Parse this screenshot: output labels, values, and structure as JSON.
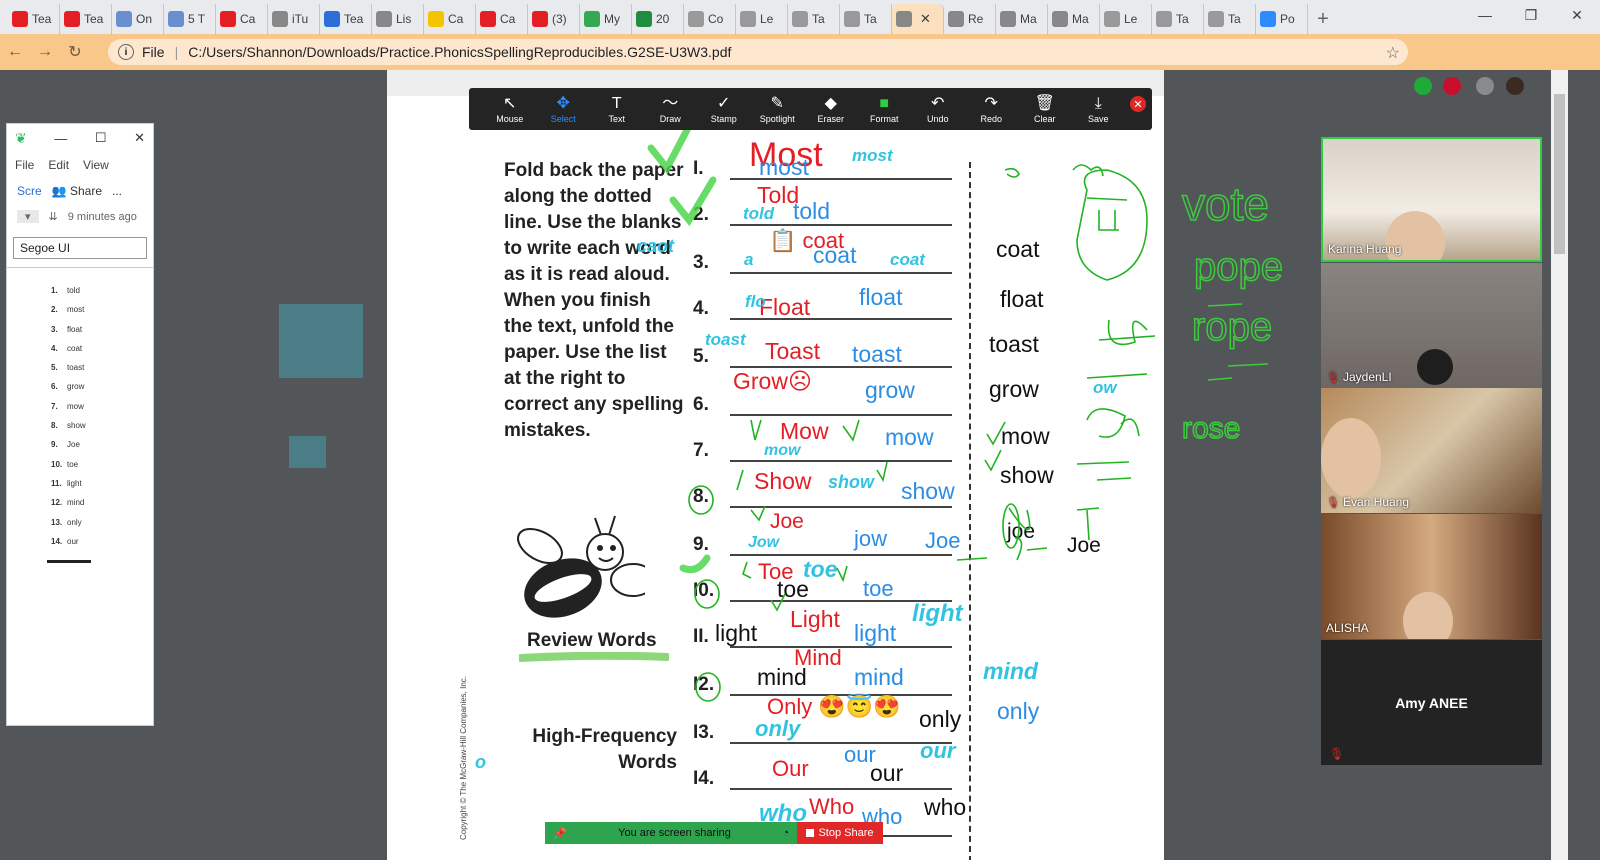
{
  "tabs": [
    {
      "label": "Tea",
      "color": "#e31e24"
    },
    {
      "label": "Tea",
      "color": "#e31e24"
    },
    {
      "label": "On",
      "color": "#6a8fcf"
    },
    {
      "label": "5 T",
      "color": "#6a8fcf"
    },
    {
      "label": "Ca",
      "color": "#e31e24"
    },
    {
      "label": "iTu",
      "color": "#888"
    },
    {
      "label": "Tea",
      "color": "#2b6fd6"
    },
    {
      "label": "Lis",
      "color": "#888"
    },
    {
      "label": "Ca",
      "color": "#f5c400"
    },
    {
      "label": "Ca",
      "color": "#e31e24"
    },
    {
      "label": "(3)",
      "color": "#e31e24"
    },
    {
      "label": "My",
      "color": "#34a853"
    },
    {
      "label": "20",
      "color": "#1e8e3e"
    },
    {
      "label": "Co",
      "color": "#999"
    },
    {
      "label": "Le",
      "color": "#999"
    },
    {
      "label": "Ta",
      "color": "#999"
    },
    {
      "label": "Ta",
      "color": "#999"
    },
    {
      "label": "",
      "color": "#888",
      "active": true
    },
    {
      "label": "Re",
      "color": "#888"
    },
    {
      "label": "Ma",
      "color": "#888"
    },
    {
      "label": "Ma",
      "color": "#888"
    },
    {
      "label": "Le",
      "color": "#999"
    },
    {
      "label": "Ta",
      "color": "#999"
    },
    {
      "label": "Ta",
      "color": "#999"
    },
    {
      "label": "Po",
      "color": "#2d8cff"
    }
  ],
  "address": {
    "scheme": "File",
    "url": "C:/Users/Shannon/Downloads/Practice.PhonicsSpellingReproducibles.G2SE-U3W3.pdf"
  },
  "notes_app": {
    "menu": [
      "File",
      "Edit",
      "View"
    ],
    "scre": "Scre",
    "share": "Share",
    "more": "...",
    "timestamp": "9 minutes ago",
    "font": "Segoe UI",
    "list": [
      {
        "n": "1.",
        "w": "told"
      },
      {
        "n": "2.",
        "w": "most"
      },
      {
        "n": "3.",
        "w": "float"
      },
      {
        "n": "4.",
        "w": "coat"
      },
      {
        "n": "5.",
        "w": "toast"
      },
      {
        "n": "6.",
        "w": "grow"
      },
      {
        "n": "7.",
        "w": "mow"
      },
      {
        "n": "8.",
        "w": "show"
      },
      {
        "n": "9.",
        "w": "Joe"
      },
      {
        "n": "10.",
        "w": "toe"
      },
      {
        "n": "11.",
        "w": "light"
      },
      {
        "n": "12.",
        "w": "mind"
      },
      {
        "n": "13.",
        "w": "only"
      },
      {
        "n": "14.",
        "w": "our"
      }
    ]
  },
  "toolbar": [
    {
      "label": "Mouse",
      "icon": "↖"
    },
    {
      "label": "Select",
      "icon": "✥",
      "selected": true
    },
    {
      "label": "Text",
      "icon": "T"
    },
    {
      "label": "Draw",
      "icon": "〜"
    },
    {
      "label": "Stamp",
      "icon": "✓"
    },
    {
      "label": "Spotlight",
      "icon": "✎"
    },
    {
      "label": "Eraser",
      "icon": "◆"
    },
    {
      "label": "Format",
      "icon": "■"
    },
    {
      "label": "Undo",
      "icon": "↶"
    },
    {
      "label": "Redo",
      "icon": "↷"
    },
    {
      "label": "Clear",
      "icon": "🗑"
    },
    {
      "label": "Save",
      "icon": "⤓"
    }
  ],
  "worksheet": {
    "instructions": "Fold back the paper along the dotted line. Use the blanks to write each word as it is read aloud. When you finish the text, unfold the paper. Use the list at the right to correct any spelling mistakes.",
    "review_words": "Review Words",
    "high_frequency": [
      "High-Frequency",
      "Words"
    ],
    "numbers": [
      "I.",
      "2.",
      "3.",
      "4.",
      "5.",
      "6.",
      "7.",
      "8.",
      "9.",
      "I0.",
      "II.",
      "I2.",
      "I3.",
      "I4."
    ],
    "copyright": "Copyright © The McGraw-Hill Companies, Inc.",
    "answer_key": [
      "coat",
      "float",
      "toast",
      "grow",
      "mow",
      "show",
      "joe",
      "Joe",
      "only",
      "who"
    ]
  },
  "annotations": {
    "red": [
      "Most",
      "Told",
      "coat",
      "Float",
      "Toast",
      "Grow",
      "Mow",
      "Show",
      "Joe",
      "Toe",
      "Light",
      "Mind",
      "Only",
      "Our",
      "Who"
    ],
    "blue": [
      "most",
      "told",
      "coat",
      "float",
      "toast",
      "grow",
      "mow",
      "show",
      "jow",
      "Joe",
      "toe",
      "light",
      "mind",
      "only",
      "our",
      "who"
    ],
    "cyan": [
      "most",
      "told",
      "caot",
      "a",
      "coat",
      "flo",
      "toast",
      "mow",
      "show",
      "Jow",
      "toe",
      "light",
      "mind",
      "only",
      "our",
      "who",
      "ow",
      "o"
    ],
    "black": [
      "toe",
      "light",
      "mind",
      "only",
      "our",
      "who"
    ],
    "green": [
      "vote",
      "pope",
      "rope",
      "rose",
      "o",
      "oa",
      "ow",
      "oe"
    ]
  },
  "share_bar": {
    "status": "You are screen sharing",
    "stop": "Stop Share"
  },
  "participants": [
    {
      "name": "Karina Huang",
      "muted": false
    },
    {
      "name": "JaydenLI",
      "muted": true
    },
    {
      "name": "Evan Huang",
      "muted": true
    },
    {
      "name": "ALISHA",
      "muted": false
    },
    {
      "name": "Amy ANEE",
      "muted": true
    }
  ]
}
